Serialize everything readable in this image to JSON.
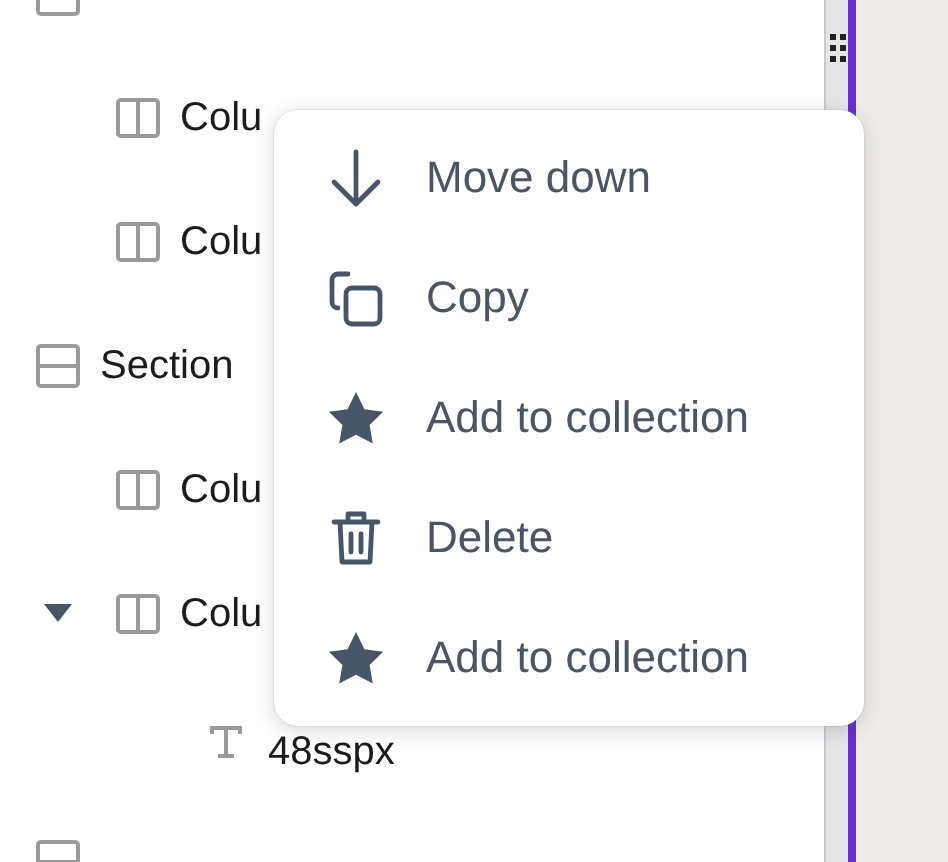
{
  "tree": [
    {
      "kind": "section",
      "children": [
        {
          "kind": "column",
          "label": "Colu"
        },
        {
          "kind": "column",
          "label": "Colu"
        }
      ]
    },
    {
      "kind": "section",
      "label": "Section",
      "children": [
        {
          "kind": "column",
          "label": "Colu"
        },
        {
          "kind": "column",
          "label": "Colu",
          "expanded": true,
          "children": [
            {
              "kind": "text",
              "label": "48sspx"
            }
          ]
        }
      ]
    },
    {
      "kind": "section"
    }
  ],
  "context_menu": {
    "items": [
      {
        "kind": "move_down",
        "label": "Move down"
      },
      {
        "kind": "copy",
        "label": "Copy"
      },
      {
        "kind": "collection",
        "label": "Add to collection"
      },
      {
        "kind": "delete",
        "label": "Delete"
      },
      {
        "kind": "collection",
        "label": "Add to collection"
      }
    ]
  }
}
